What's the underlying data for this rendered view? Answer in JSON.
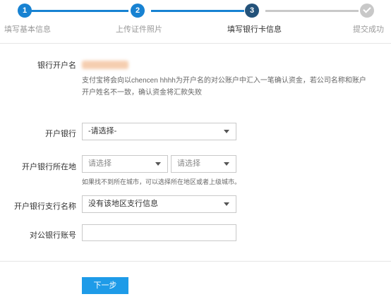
{
  "stepper": {
    "steps": [
      {
        "number": "1",
        "label": "填写基本信息"
      },
      {
        "number": "2",
        "label": "上传证件照片"
      },
      {
        "number": "3",
        "label": "填写银行卡信息"
      },
      {
        "number": "",
        "label": "提交成功"
      }
    ]
  },
  "form": {
    "account_name_label": "银行开户名",
    "account_name_note": "支付宝将会向以chencen hhhh为开户名的对公账户中汇入一笔确认资金，若公司名称和账户开户姓名不一致，确认资金将汇款失败",
    "bank_label": "开户银行",
    "bank_value": "-请选择-",
    "location_label": "开户银行所在地",
    "province_value": "请选择",
    "city_value": "请选择",
    "location_hint": "如果找不到所在城市，可以选择所在地区或者上级城市。",
    "branch_label": "开户银行支行名称",
    "branch_value": "没有该地区支行信息",
    "account_number_label": "对公银行账号",
    "account_number_value": "",
    "next_button": "下一步"
  },
  "colors": {
    "step_active": "#1782d2",
    "step_current": "#23527a",
    "step_inactive": "#c8c8c8",
    "button": "#1e9be8"
  }
}
